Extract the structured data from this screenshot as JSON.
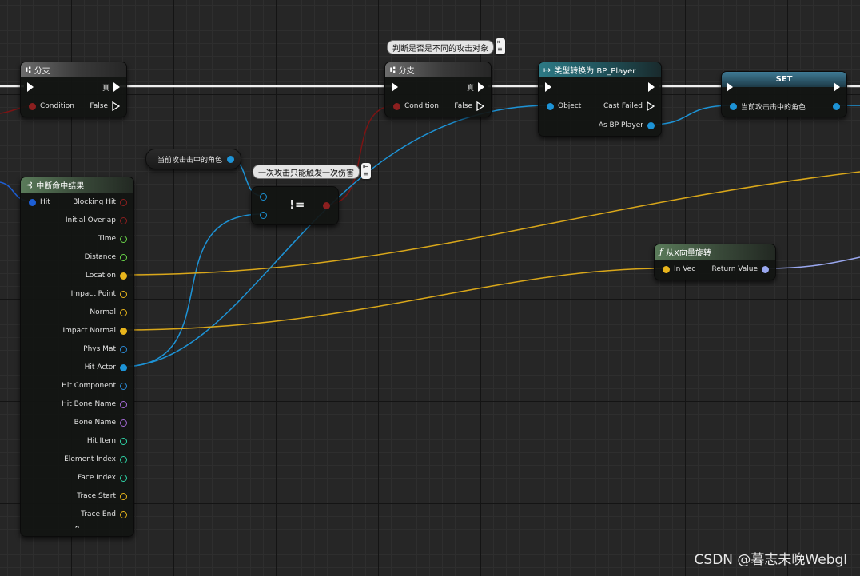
{
  "colors": {
    "exec": "#ffffff",
    "boolean": "#8c1f1f",
    "object": "#1d93d6",
    "vector": "#e8b51c",
    "float": "#6ad64a",
    "name": "#a46ad6",
    "struct_blue": "#2b8bd8",
    "integer": "#2fd6a8",
    "rotator": "#9aa8f0",
    "string": "#e34fb1",
    "hit_result": "#1d5fd6"
  },
  "branch1": {
    "title": "分支",
    "true_label": "真",
    "condition_label": "Condition",
    "false_label": "False"
  },
  "branch2": {
    "title": "分支",
    "true_label": "真",
    "condition_label": "Condition",
    "false_label": "False",
    "comment": "判断是否是不同的攻击对象"
  },
  "cast": {
    "title": "类型转换为 BP_Player",
    "object_label": "Object",
    "cast_failed_label": "Cast Failed",
    "as_label": "As BP Player"
  },
  "set": {
    "title": "SET",
    "var_label": "当前攻击击中的角色"
  },
  "getter": {
    "label": "当前攻击击中的角色"
  },
  "neq": {
    "symbol": "!=",
    "comment": "一次攻击只能触发一次伤害"
  },
  "rotx": {
    "title": "从X向量旋转",
    "in_label": "In Vec",
    "out_label": "Return Value"
  },
  "breakhit": {
    "title": "中断命中结果",
    "input_label": "Hit",
    "outputs": [
      {
        "label": "Blocking Hit"
      },
      {
        "label": "Initial Overlap"
      },
      {
        "label": "Time"
      },
      {
        "label": "Distance"
      },
      {
        "label": "Location"
      },
      {
        "label": "Impact Point"
      },
      {
        "label": "Normal"
      },
      {
        "label": "Impact Normal"
      },
      {
        "label": "Phys Mat"
      },
      {
        "label": "Hit Actor"
      },
      {
        "label": "Hit Component"
      },
      {
        "label": "Hit Bone Name"
      },
      {
        "label": "Bone Name"
      },
      {
        "label": "Hit Item"
      },
      {
        "label": "Element Index"
      },
      {
        "label": "Face Index"
      },
      {
        "label": "Trace Start"
      },
      {
        "label": "Trace End"
      }
    ]
  },
  "watermark": "CSDN @暮志未晚Webgl"
}
